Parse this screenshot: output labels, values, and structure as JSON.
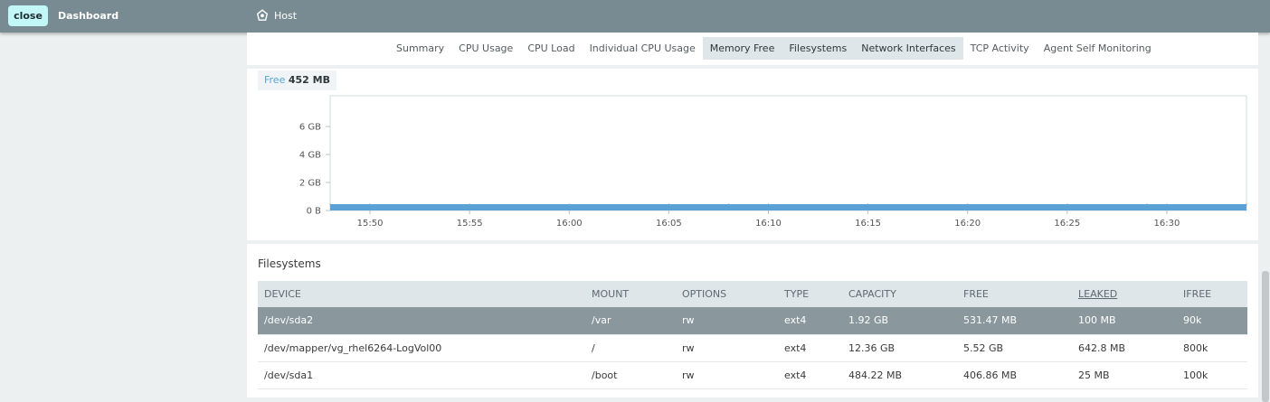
{
  "topbar": {
    "close_label": "close",
    "dashboard_label": "Dashboard",
    "host_label": "Host"
  },
  "tabs": [
    {
      "label": "Summary",
      "active": false
    },
    {
      "label": "CPU Usage",
      "active": false
    },
    {
      "label": "CPU Load",
      "active": false
    },
    {
      "label": "Individual CPU Usage",
      "active": false
    },
    {
      "label": "Memory Free",
      "active": true
    },
    {
      "label": "Filesystems",
      "active": true
    },
    {
      "label": "Network Interfaces",
      "active": true
    },
    {
      "label": "TCP Activity",
      "active": false
    },
    {
      "label": "Agent Self Monitoring",
      "active": false
    }
  ],
  "memory": {
    "legend_label": "Free",
    "legend_value": "452 MB"
  },
  "chart_data": {
    "type": "area",
    "x": [
      "15:48",
      "15:50",
      "15:55",
      "16:00",
      "16:05",
      "16:08",
      "16:10",
      "16:15",
      "16:20",
      "16:25",
      "16:29",
      "16:30",
      "16:34"
    ],
    "series": [
      {
        "name": "Free",
        "values": [
          0.45,
          0.45,
          0.45,
          0.45,
          0.45,
          0.45,
          0.45,
          0.45,
          0.45,
          0.45,
          0.45,
          0.45,
          0.45
        ]
      }
    ],
    "x_ticks": [
      "15:50",
      "15:55",
      "16:00",
      "16:05",
      "16:10",
      "16:15",
      "16:20",
      "16:25",
      "16:30"
    ],
    "y_ticks": [
      "0 B",
      "2 GB",
      "4 GB",
      "6 GB"
    ],
    "ylim": [
      0,
      8.2
    ],
    "color": "#5aa2d6",
    "grid": false
  },
  "filesystems": {
    "title": "Filesystems",
    "columns": [
      {
        "label": "DEVICE",
        "underline": false
      },
      {
        "label": "MOUNT",
        "underline": false
      },
      {
        "label": "OPTIONS",
        "underline": false
      },
      {
        "label": "TYPE",
        "underline": false
      },
      {
        "label": "CAPACITY",
        "underline": false
      },
      {
        "label": "FREE",
        "underline": false
      },
      {
        "label": "LEAKED",
        "underline": true
      },
      {
        "label": "IFREE",
        "underline": false
      }
    ],
    "rows": [
      {
        "selected": true,
        "cells": [
          "/dev/sda2",
          "/var",
          "rw",
          "ext4",
          "1.92 GB",
          "531.47 MB",
          "100 MB",
          "90k"
        ]
      },
      {
        "selected": false,
        "cells": [
          "/dev/mapper/vg_rhel6264-LogVol00",
          "/",
          "rw",
          "ext4",
          "12.36 GB",
          "5.52 GB",
          "642.8 MB",
          "800k"
        ]
      },
      {
        "selected": false,
        "cells": [
          "/dev/sda1",
          "/boot",
          "rw",
          "ext4",
          "484.22 MB",
          "406.86 MB",
          "25 MB",
          "100k"
        ]
      }
    ]
  },
  "colors": {
    "topbar": "#788b92",
    "close_button": "#c3f6f6",
    "series": "#5aa2d6",
    "selected_row": "#8a989e"
  }
}
